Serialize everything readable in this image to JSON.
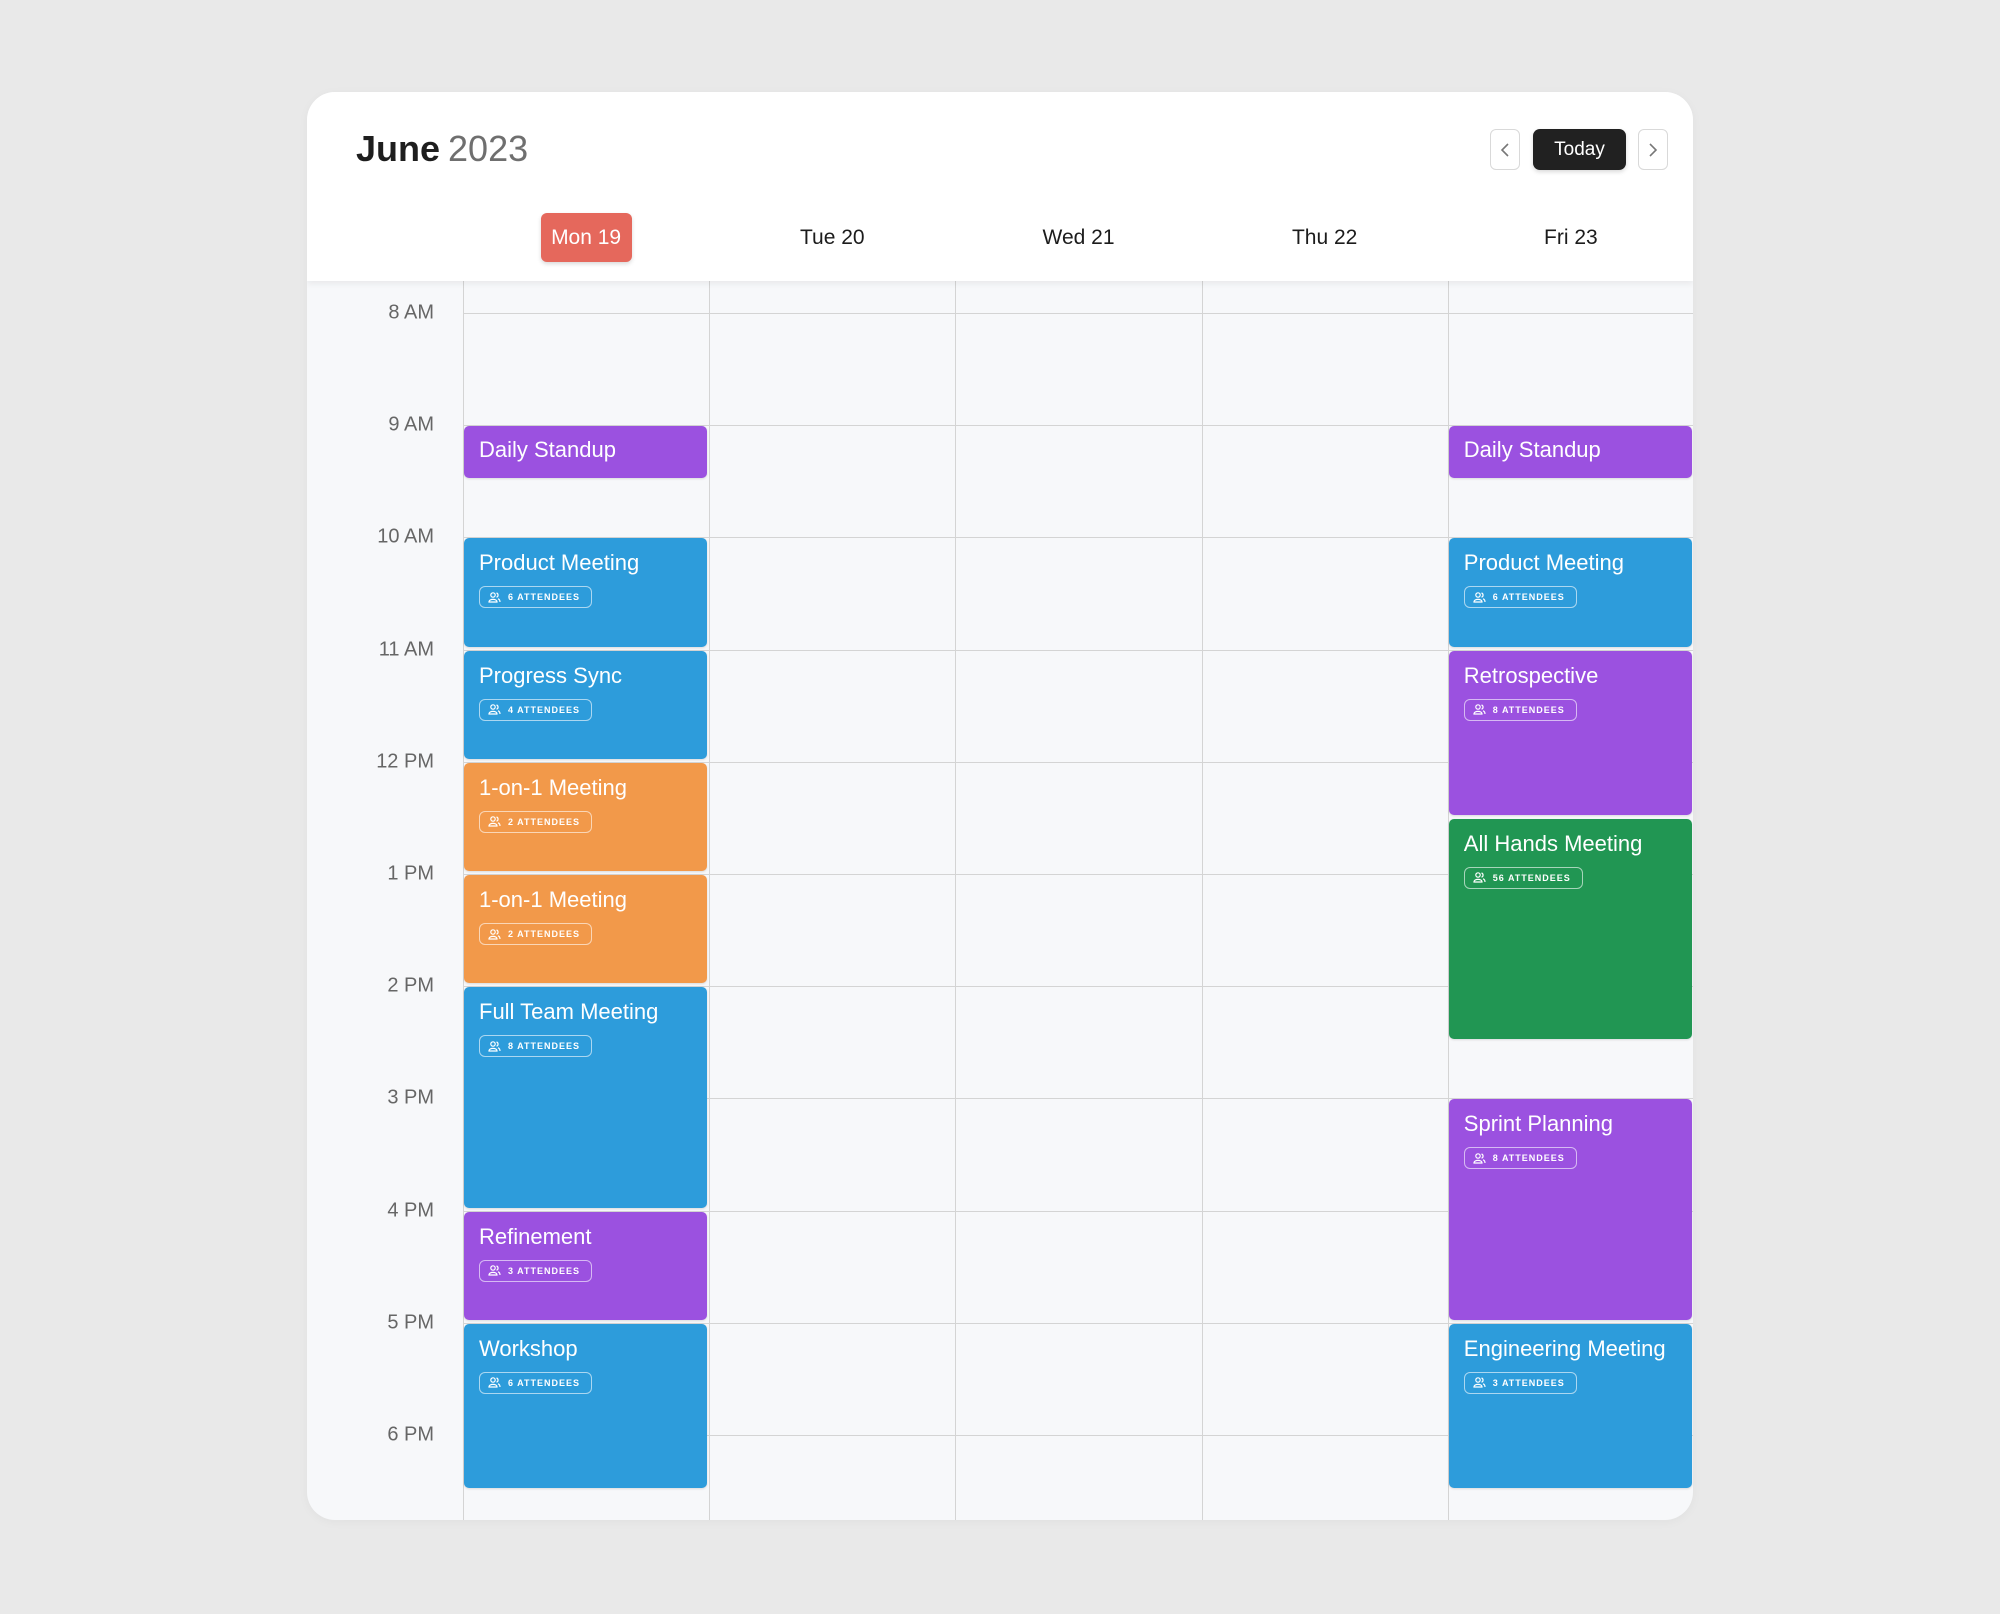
{
  "header": {
    "month": "June",
    "year": "2023",
    "today_label": "Today",
    "prev_icon": "chevron-left-icon",
    "next_icon": "chevron-right-icon"
  },
  "days": [
    {
      "label": "Mon 19",
      "active": true
    },
    {
      "label": "Tue 20",
      "active": false
    },
    {
      "label": "Wed 21",
      "active": false
    },
    {
      "label": "Thu 22",
      "active": false
    },
    {
      "label": "Fri 23",
      "active": false
    }
  ],
  "hours": [
    "8 AM",
    "9 AM",
    "10 AM",
    "11 AM",
    "12 PM",
    "1 PM",
    "2 PM",
    "3 PM",
    "4 PM",
    "5 PM",
    "6 PM"
  ],
  "colors": {
    "today": "#e5685c",
    "purple": "#9b51e0",
    "blue": "#2d9cdb",
    "orange": "#f2994a",
    "green": "#219653"
  },
  "events": [
    {
      "day": 0,
      "title": "Daily Standup",
      "start": 9,
      "end": 9.5,
      "color": "purple",
      "attendees": null
    },
    {
      "day": 0,
      "title": "Product Meeting",
      "start": 10,
      "end": 11,
      "color": "blue",
      "attendees": "6 ATTENDEES"
    },
    {
      "day": 0,
      "title": "Progress Sync",
      "start": 11,
      "end": 12,
      "color": "blue",
      "attendees": "4 ATTENDEES"
    },
    {
      "day": 0,
      "title": "1-on-1 Meeting",
      "start": 12,
      "end": 13,
      "color": "orange",
      "attendees": "2 ATTENDEES"
    },
    {
      "day": 0,
      "title": "1-on-1 Meeting",
      "start": 13,
      "end": 14,
      "color": "orange",
      "attendees": "2 ATTENDEES"
    },
    {
      "day": 0,
      "title": "Full Team Meeting",
      "start": 14,
      "end": 16,
      "color": "blue",
      "attendees": "8 ATTENDEES"
    },
    {
      "day": 0,
      "title": "Refinement",
      "start": 16,
      "end": 17,
      "color": "purple",
      "attendees": "3 ATTENDEES"
    },
    {
      "day": 0,
      "title": "Workshop",
      "start": 17,
      "end": 18.5,
      "color": "blue",
      "attendees": "6 ATTENDEES"
    },
    {
      "day": 4,
      "title": "Daily Standup",
      "start": 9,
      "end": 9.5,
      "color": "purple",
      "attendees": null
    },
    {
      "day": 4,
      "title": "Product Meeting",
      "start": 10,
      "end": 11,
      "color": "blue",
      "attendees": "6 ATTENDEES"
    },
    {
      "day": 4,
      "title": "Retrospective",
      "start": 11,
      "end": 12.5,
      "color": "purple",
      "attendees": "8 ATTENDEES"
    },
    {
      "day": 4,
      "title": "All Hands Meeting",
      "start": 12.5,
      "end": 14.5,
      "color": "green",
      "attendees": "56 ATTENDEES"
    },
    {
      "day": 4,
      "title": "Sprint Planning",
      "start": 15,
      "end": 17,
      "color": "purple",
      "attendees": "8 ATTENDEES"
    },
    {
      "day": 4,
      "title": "Engineering Meeting",
      "start": 17,
      "end": 18.5,
      "color": "blue",
      "attendees": "3 ATTENDEES"
    }
  ]
}
